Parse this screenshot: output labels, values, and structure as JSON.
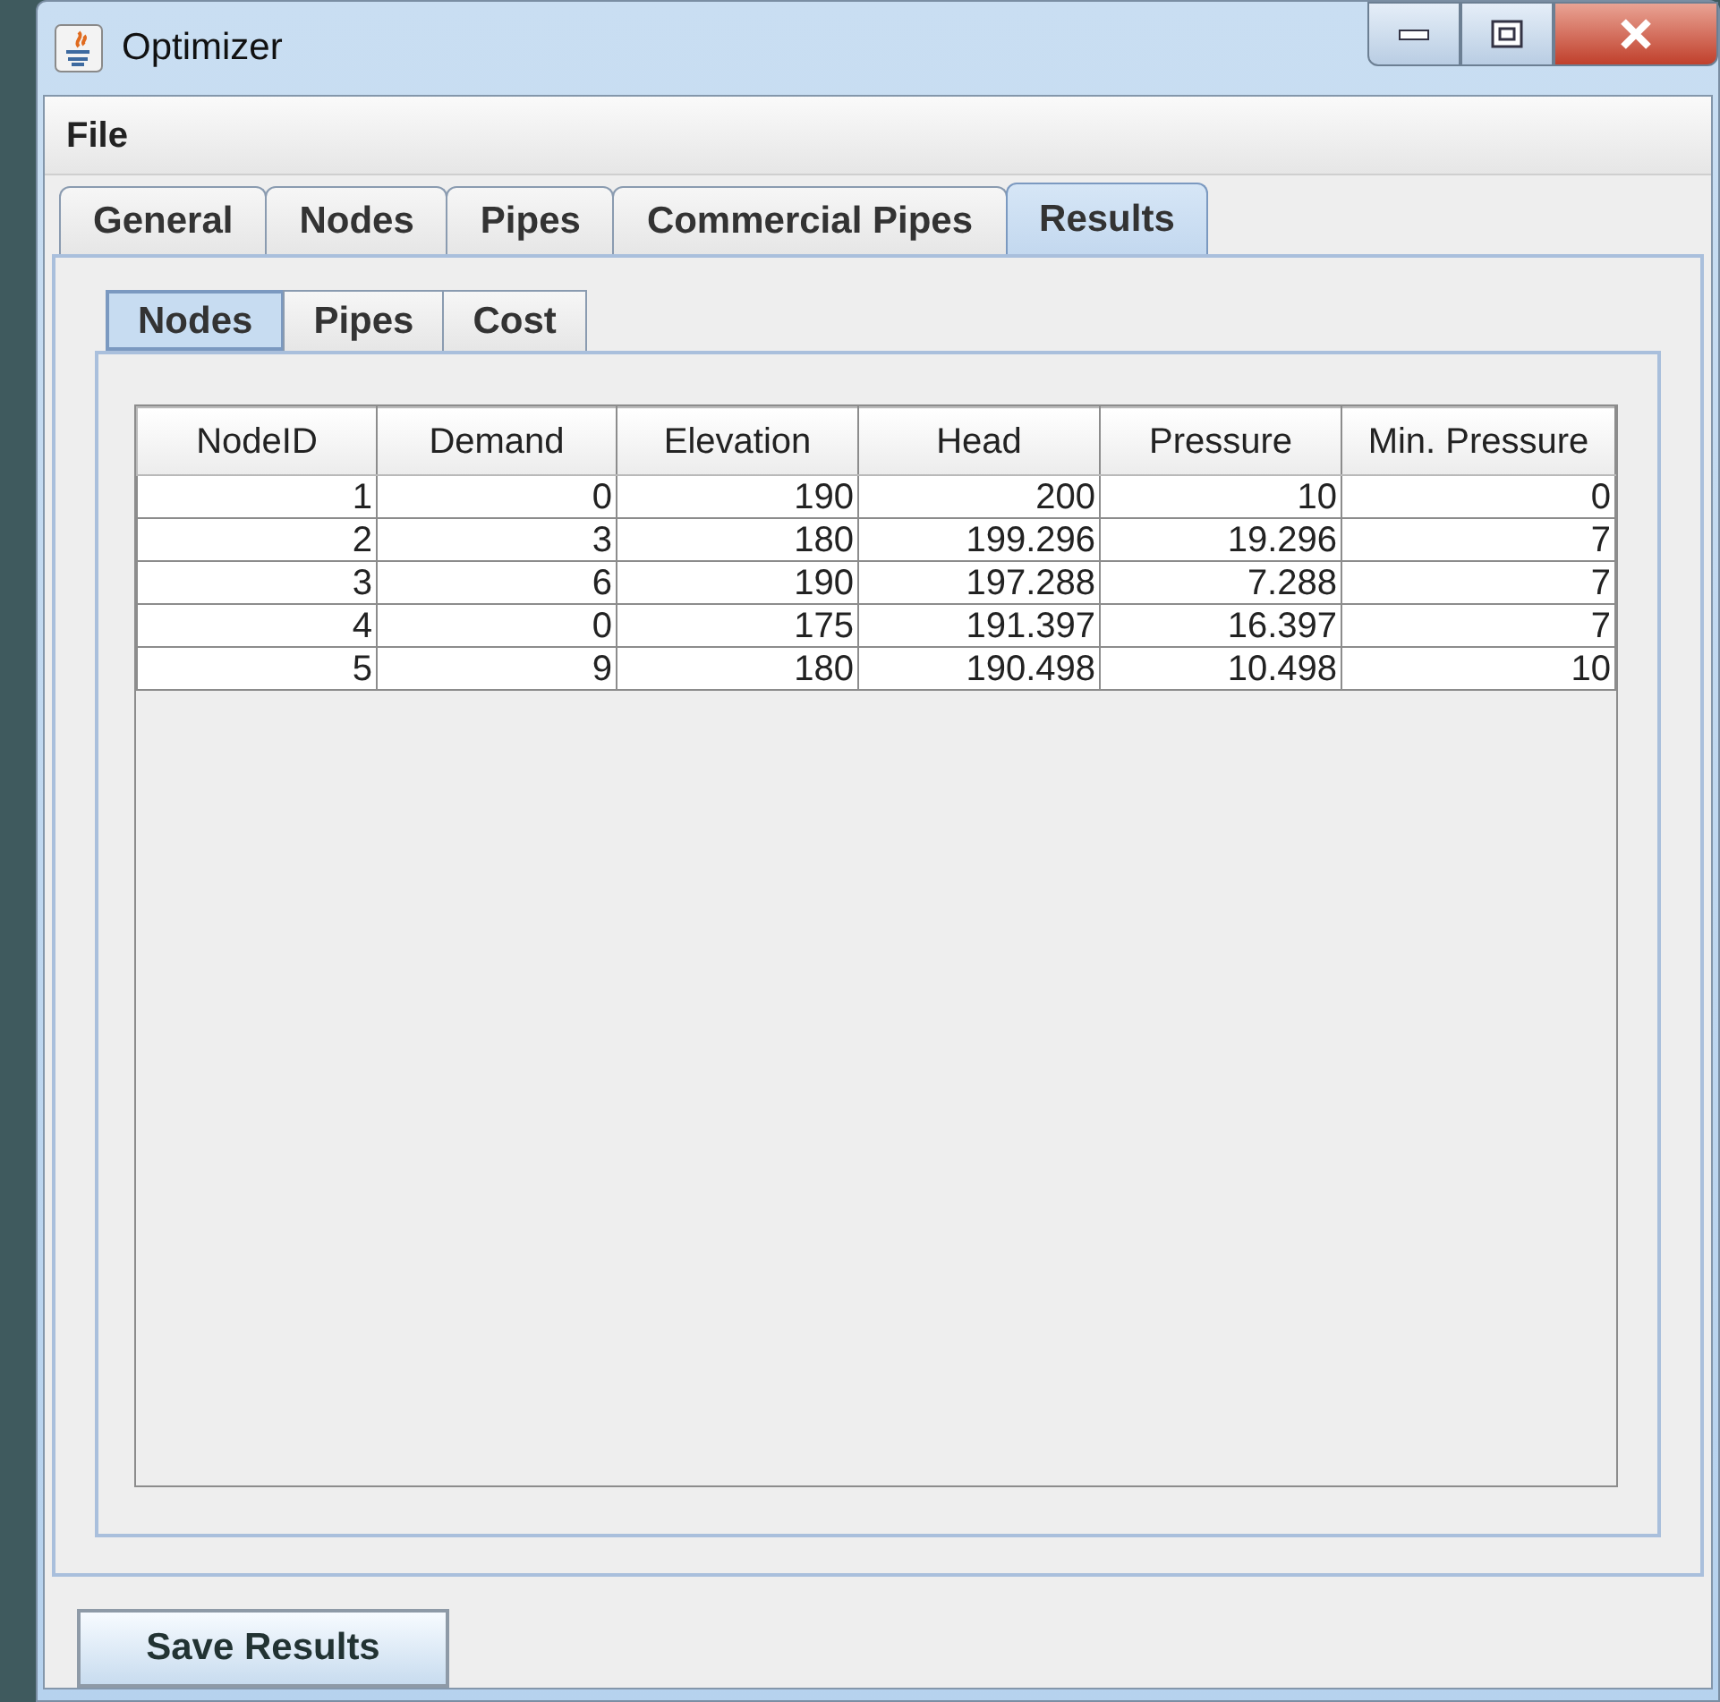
{
  "window": {
    "title": "Optimizer"
  },
  "menu": [
    "File"
  ],
  "tabs": [
    {
      "label": "General",
      "selected": false
    },
    {
      "label": "Nodes",
      "selected": false
    },
    {
      "label": "Pipes",
      "selected": false
    },
    {
      "label": "Commercial Pipes",
      "selected": false
    },
    {
      "label": "Results",
      "selected": true
    }
  ],
  "subtabs": [
    {
      "label": "Nodes",
      "selected": true
    },
    {
      "label": "Pipes",
      "selected": false
    },
    {
      "label": "Cost",
      "selected": false
    }
  ],
  "table": {
    "columns": [
      "NodeID",
      "Demand",
      "Elevation",
      "Head",
      "Pressure",
      "Min. Pressure"
    ],
    "rows": [
      [
        "1",
        "0",
        "190",
        "200",
        "10",
        "0"
      ],
      [
        "2",
        "3",
        "180",
        "199.296",
        "19.296",
        "7"
      ],
      [
        "3",
        "6",
        "190",
        "197.288",
        "7.288",
        "7"
      ],
      [
        "4",
        "0",
        "175",
        "191.397",
        "16.397",
        "7"
      ],
      [
        "5",
        "9",
        "180",
        "190.498",
        "10.498",
        "10"
      ]
    ]
  },
  "buttons": [
    "Save Results"
  ]
}
